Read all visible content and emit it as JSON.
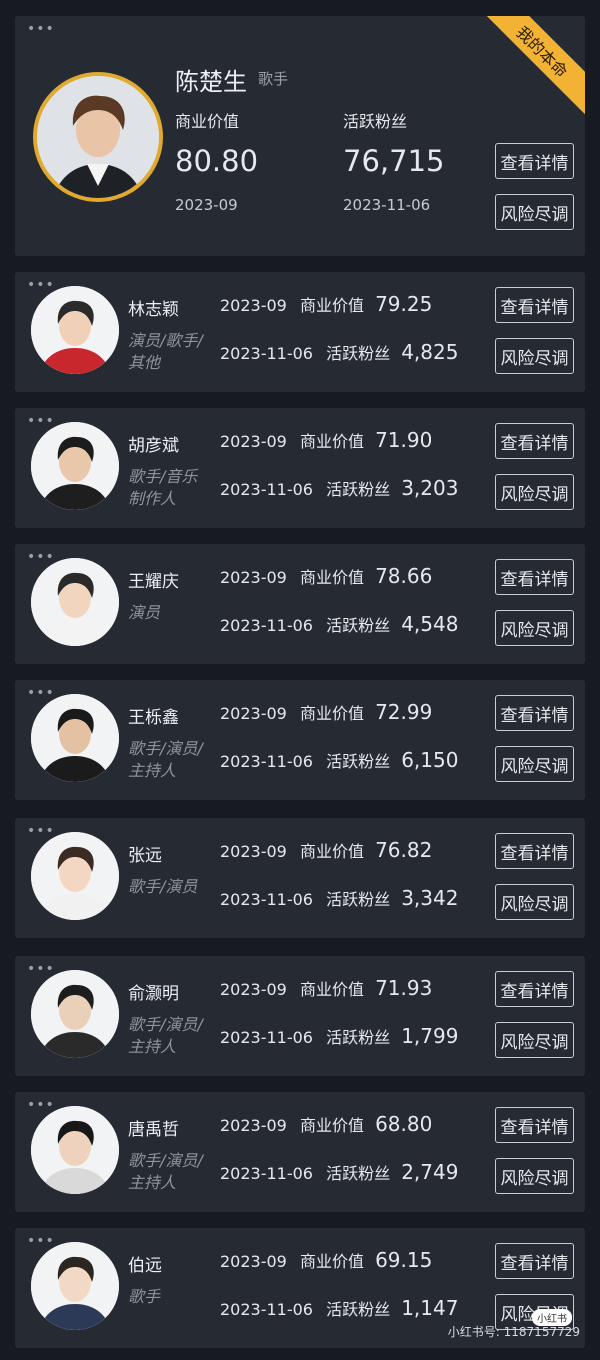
{
  "featured": {
    "name": "陈楚生",
    "role": "歌手",
    "ribbon": "我的本命",
    "metric1_label": "商业价值",
    "metric1_value": "80.80",
    "metric1_date": "2023-09",
    "metric2_label": "活跃粉丝",
    "metric2_value": "76,715",
    "metric2_date": "2023-11-06",
    "detail_btn": "查看详情",
    "risk_btn": "风险尽调"
  },
  "list_labels": {
    "biz_label": "商业价值",
    "fans_label": "活跃粉丝",
    "biz_date": "2023-09",
    "fans_date": "2023-11-06",
    "detail_btn": "查看详情",
    "risk_btn": "风险尽调"
  },
  "items": [
    {
      "name": "林志颖",
      "tags1": "演员/歌手/",
      "tags2": "其他",
      "biz": "79.25",
      "fans": "4,825"
    },
    {
      "name": "胡彦斌",
      "tags1": "歌手/音乐",
      "tags2": "制作人",
      "biz": "71.90",
      "fans": "3,203"
    },
    {
      "name": "王耀庆",
      "tags1": "演员",
      "tags2": "",
      "biz": "78.66",
      "fans": "4,548"
    },
    {
      "name": "王栎鑫",
      "tags1": "歌手/演员/",
      "tags2": "主持人",
      "biz": "72.99",
      "fans": "6,150"
    },
    {
      "name": "张远",
      "tags1": "歌手/演员",
      "tags2": "",
      "biz": "76.82",
      "fans": "3,342"
    },
    {
      "name": "俞灏明",
      "tags1": "歌手/演员/",
      "tags2": "主持人",
      "biz": "71.93",
      "fans": "1,799"
    },
    {
      "name": "唐禹哲",
      "tags1": "歌手/演员/",
      "tags2": "主持人",
      "biz": "68.80",
      "fans": "2,749"
    },
    {
      "name": "伯远",
      "tags1": "歌手",
      "tags2": "",
      "biz": "69.15",
      "fans": "1,147"
    }
  ],
  "watermark": {
    "badge": "小红书",
    "text": "小红书号: 1187157729"
  },
  "colors": {
    "accent_gold": "#f2b233",
    "card_bg": "#262b33",
    "page_bg": "#171a20"
  }
}
